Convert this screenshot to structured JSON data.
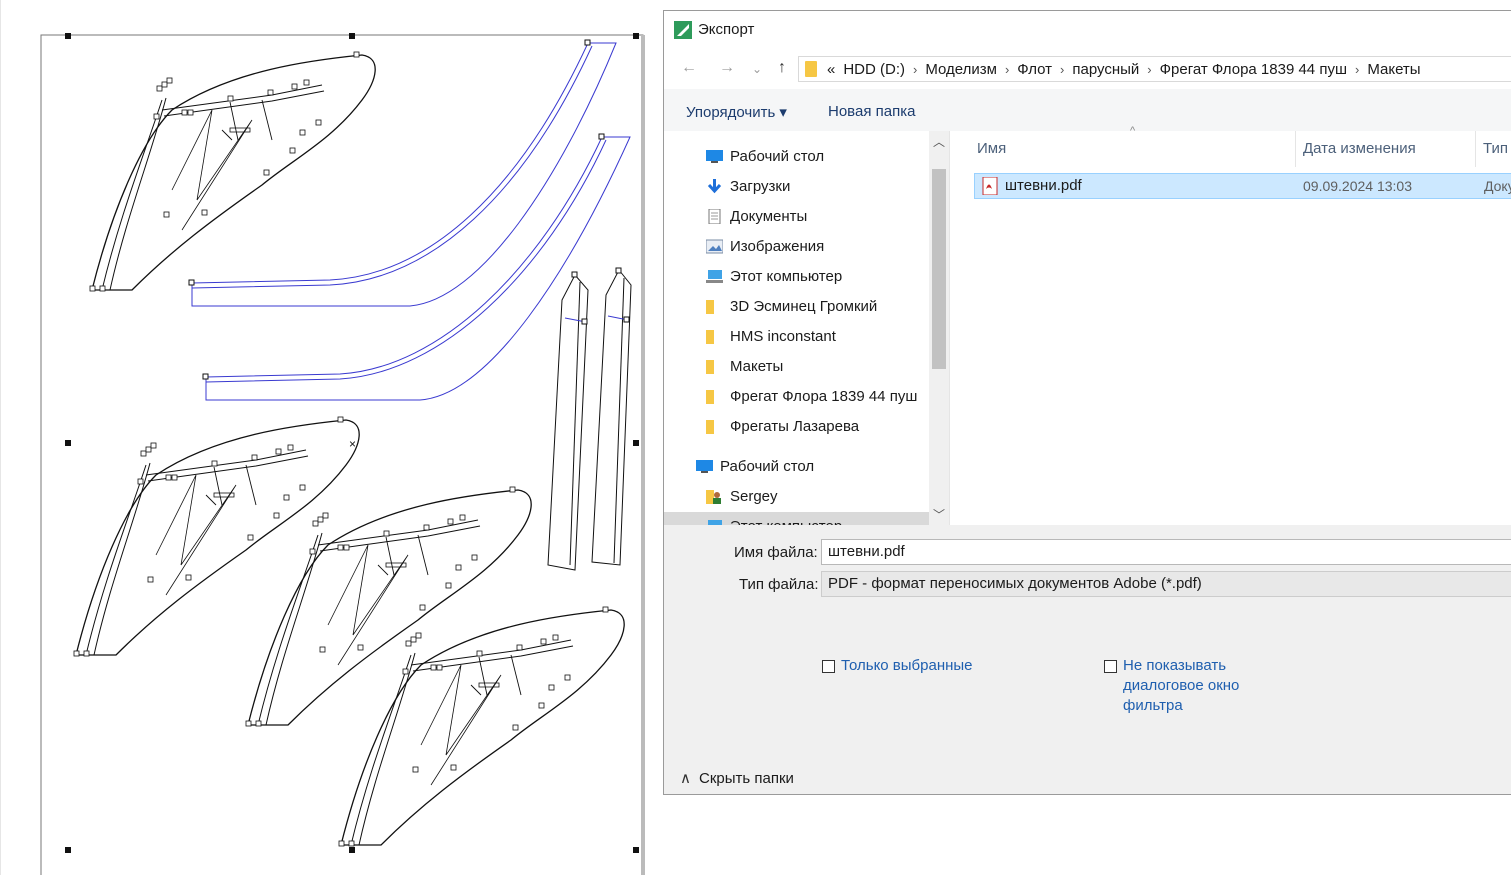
{
  "dialog": {
    "title": "Экспорт",
    "breadcrumb": {
      "overflow": "«",
      "items": [
        "HDD (D:)",
        "Моделизм",
        "Флот",
        "парусный",
        "Фрегат Флора 1839 44 пуш",
        "Макеты"
      ]
    },
    "toolbar": {
      "organize": "Упорядочить ▾",
      "new_folder": "Новая папка"
    },
    "nav": {
      "quick_access": [
        {
          "label": "Рабочий стол",
          "icon": "desktop-icon",
          "pinned": true
        },
        {
          "label": "Загрузки",
          "icon": "download-icon",
          "pinned": true
        },
        {
          "label": "Документы",
          "icon": "documents-icon",
          "pinned": true
        },
        {
          "label": "Изображения",
          "icon": "pictures-icon",
          "pinned": true
        },
        {
          "label": "Этот компьютер",
          "icon": "computer-icon",
          "pinned": true
        },
        {
          "label": "3D Эсминец Громкий",
          "icon": "folder-icon",
          "pinned": true
        },
        {
          "label": "HMS inconstant",
          "icon": "folder-icon",
          "pinned": false
        },
        {
          "label": "Макеты",
          "icon": "folder-icon",
          "pinned": false
        },
        {
          "label": "Фрегат Флора 1839 44 пуш",
          "icon": "folder-icon",
          "pinned": false
        },
        {
          "label": "Фрегаты Лазарева",
          "icon": "folder-icon",
          "pinned": false
        }
      ],
      "tree": [
        {
          "label": "Рабочий стол",
          "icon": "desktop-icon"
        },
        {
          "label": "Sergey",
          "icon": "user-folder-icon"
        },
        {
          "label": "Этот компьютер",
          "icon": "computer-icon"
        }
      ]
    },
    "columns": {
      "name": "Имя",
      "date": "Дата изменения",
      "type": "Тип"
    },
    "files": [
      {
        "name": "штевни.pdf",
        "date": "09.09.2024 13:03",
        "type": "Доку"
      }
    ],
    "filename_label": "Имя файла:",
    "filename_value": "штевни.pdf",
    "filetype_label": "Тип файла:",
    "filetype_value": "PDF - формат переносимых документов Adobe (*.pdf)",
    "only_selected": "Только выбранные",
    "dont_show_filter": "Не показывать диалоговое окно фильтра",
    "hide_folders": "Скрыть папки"
  },
  "colors": {
    "accent": "#1f5faf",
    "selection": "#cce8ff",
    "curve_blue": "#3a3ad0",
    "app_green": "#2e9b5b"
  }
}
